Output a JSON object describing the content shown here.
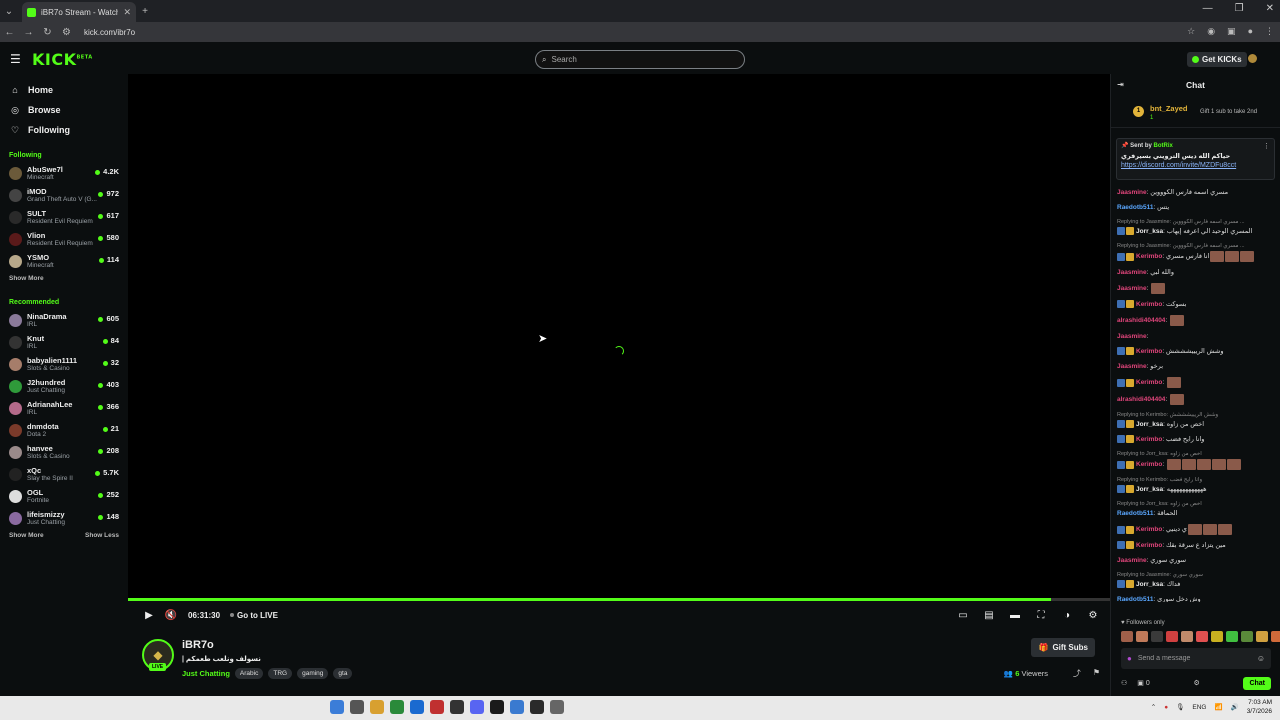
{
  "browser": {
    "tab_title": "iBR7o Stream - Watch Live on K...",
    "url": "kick.com/ibr7o"
  },
  "header": {
    "logo": "KICK",
    "logo_sup": "BETA",
    "search_placeholder": "Search",
    "get_kicks": "Get KICKs"
  },
  "sidebar": {
    "nav": [
      {
        "label": "Home",
        "icon": "home-icon"
      },
      {
        "label": "Browse",
        "icon": "compass-icon"
      },
      {
        "label": "Following",
        "icon": "heart-icon"
      }
    ],
    "following_title": "Following",
    "following": [
      {
        "name": "AbuSwe7l",
        "game": "Minecraft",
        "viewers": "4.2K",
        "color": "#6b5a3a"
      },
      {
        "name": "iMOD",
        "game": "Grand Theft Auto V (G...",
        "viewers": "972",
        "color": "#444"
      },
      {
        "name": "SULT",
        "game": "Resident Evil Requiem",
        "viewers": "617",
        "color": "#2a2a2a"
      },
      {
        "name": "Vlion",
        "game": "Resident Evil Requiem",
        "viewers": "580",
        "color": "#5a1a1a"
      },
      {
        "name": "YSMO",
        "game": "Minecraft",
        "viewers": "114",
        "color": "#b7a88a"
      }
    ],
    "show_more_1": "Show More",
    "recommended_title": "Recommended",
    "recommended": [
      {
        "name": "NinaDrama",
        "game": "IRL",
        "viewers": "605",
        "color": "#8a7a9a"
      },
      {
        "name": "Knut",
        "game": "IRL",
        "viewers": "84",
        "color": "#333"
      },
      {
        "name": "babyalien1111",
        "game": "Slots & Casino",
        "viewers": "32",
        "color": "#a67d6a"
      },
      {
        "name": "J2hundred",
        "game": "Just Chatting",
        "viewers": "403",
        "color": "#2f9a3a"
      },
      {
        "name": "AdrianahLee",
        "game": "IRL",
        "viewers": "366",
        "color": "#b46a8a"
      },
      {
        "name": "dnmdota",
        "game": "Dota 2",
        "viewers": "21",
        "color": "#7a3a2a"
      },
      {
        "name": "hanvee",
        "game": "Slots & Casino",
        "viewers": "208",
        "color": "#9a8a8a"
      },
      {
        "name": "xQc",
        "game": "Slay the Spire II",
        "viewers": "5.7K",
        "color": "#222"
      },
      {
        "name": "OGL",
        "game": "Fortnite",
        "viewers": "252",
        "color": "#ddd"
      },
      {
        "name": "lifeismizzy",
        "game": "Just Chatting",
        "viewers": "148",
        "color": "#8a6aa0"
      }
    ],
    "show_more_2": "Show More",
    "show_less": "Show Less"
  },
  "player": {
    "time": "06:31:30",
    "go_live": "Go to LIVE",
    "progress": 0.94
  },
  "channel": {
    "name": "iBR7o",
    "live": "LIVE",
    "title": "| نسولف ونلعب طعمكم",
    "category": "Just Chatting",
    "tags": [
      "Arabic",
      "TRG",
      "gaming",
      "gta"
    ],
    "gift_subs": "Gift Subs",
    "viewers_count": "6",
    "viewers_label": "Viewers"
  },
  "chat": {
    "title": "Chat",
    "gifter": {
      "name": "bnt_Zayed",
      "count": "1",
      "text": "Gift 1 sub to take 2nd",
      "rank": "1"
    },
    "pinned": {
      "header_prefix": "Sent by",
      "author": "BotRix",
      "text": "حياكم الله ديس الترويني بسيرفري",
      "link": "https://discord.com/invite/MZDFu8cct"
    },
    "messages": [
      {
        "reply": "",
        "user": "Jaasmine",
        "color": "#e0457b",
        "text": "مسري اسمه فارس الكوووين",
        "badges": 0,
        "emotes": 0
      },
      {
        "reply": "",
        "user": "Raedotb511",
        "color": "#5aa7ff",
        "text": "يتس",
        "badges": 0,
        "emotes": 0
      },
      {
        "reply": "Replying to Jaasmine: مسري اسمه فارس الكوووين ...",
        "user": "Jorr_ksa",
        "color": "#eee",
        "text": "المسري الوحيد الي اعرفه إيهاب",
        "badges": 2,
        "emotes": 0
      },
      {
        "reply": "Replying to Jaasmine: مسري اسمه فارس الكوووين ...",
        "user": "Kerimbo",
        "color": "#e0457b",
        "text": "انا فارس مسري",
        "badges": 2,
        "emotes": 3
      },
      {
        "reply": "",
        "user": "Jaasmine",
        "color": "#e0457b",
        "text": "والله لبي",
        "badges": 0,
        "emotes": 0
      },
      {
        "reply": "",
        "user": "Jaasmine",
        "color": "#e0457b",
        "text": "",
        "badges": 0,
        "emotes": 1
      },
      {
        "reply": "",
        "user": "Kerimbo",
        "color": "#e0457b",
        "text": "بسوكت",
        "badges": 2,
        "emotes": 0
      },
      {
        "reply": "",
        "user": "alrashidi404404",
        "color": "#e0457b",
        "text": "",
        "badges": 0,
        "emotes": 1
      },
      {
        "reply": "",
        "user": "Jaasmine",
        "color": "#e0457b",
        "text": "",
        "badges": 0,
        "emotes": 0
      },
      {
        "reply": "",
        "user": "Kerimbo",
        "color": "#e0457b",
        "text": "وشش الريييشششش",
        "badges": 2,
        "emotes": 0
      },
      {
        "reply": "",
        "user": "Jaasmine",
        "color": "#e0457b",
        "text": "برخو",
        "badges": 0,
        "emotes": 0
      },
      {
        "reply": "",
        "user": "Kerimbo",
        "color": "#e0457b",
        "text": "",
        "badges": 2,
        "emotes": 1
      },
      {
        "reply": "",
        "user": "alrashidi404404",
        "color": "#e0457b",
        "text": "",
        "badges": 0,
        "emotes": 1
      },
      {
        "reply": "Replying to Kerimbo: وشش الريييشششش",
        "user": "Jorr_ksa",
        "color": "#eee",
        "text": "اخص من زاوه",
        "badges": 2,
        "emotes": 0
      },
      {
        "reply": "",
        "user": "Kerimbo",
        "color": "#e0457b",
        "text": "وانا رايح فضب",
        "badges": 2,
        "emotes": 0
      },
      {
        "reply": "Replying to Jorr_ksa: اخص من زاوه",
        "user": "Kerimbo",
        "color": "#e0457b",
        "text": "",
        "badges": 2,
        "emotes": 5
      },
      {
        "reply": "Replying to Kerimbo: وانا رايح فضب",
        "user": "Jorr_ksa",
        "color": "#eee",
        "text": "ههههههههههههه",
        "badges": 2,
        "emotes": 0
      },
      {
        "reply": "Replying to Jorr_ksa: اخص من زاوه",
        "user": "Raedotb511",
        "color": "#5aa7ff",
        "text": "الحماقة",
        "badges": 0,
        "emotes": 0
      },
      {
        "reply": "",
        "user": "Kerimbo",
        "color": "#e0457b",
        "text": "ي دينيي",
        "badges": 2,
        "emotes": 3
      },
      {
        "reply": "",
        "user": "Kerimbo",
        "color": "#e0457b",
        "text": "مين يتزاد ع سرقة بقك",
        "badges": 2,
        "emotes": 0
      },
      {
        "reply": "",
        "user": "Jaasmine",
        "color": "#e0457b",
        "text": "سوري سوري",
        "badges": 0,
        "emotes": 0
      },
      {
        "reply": "Replying to Jaasmine: سوري سوري",
        "user": "Jorr_ksa",
        "color": "#eee",
        "text": "فداك",
        "badges": 2,
        "emotes": 0
      },
      {
        "reply": "",
        "user": "Raedotb511",
        "color": "#5aa7ff",
        "text": "وش دخل سوري",
        "badges": 0,
        "emotes": 0
      }
    ],
    "followers_only": "Followers only",
    "input_placeholder": "Send a message",
    "points": "0",
    "send_label": "Chat"
  },
  "taskbar": {
    "lang": "ENG",
    "time": "7:03 AM",
    "date": "3/7/2026"
  }
}
